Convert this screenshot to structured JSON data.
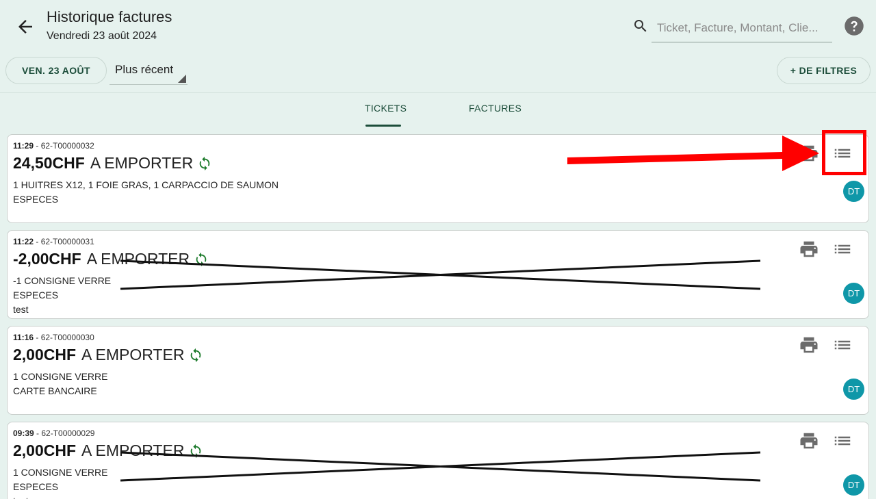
{
  "header": {
    "title": "Historique factures",
    "subtitle": "Vendredi 23 août 2024",
    "search_placeholder": "Ticket, Facture, Montant, Clie..."
  },
  "filters": {
    "date_label": "VEN. 23 AOÛT",
    "sort_value": "Plus récent",
    "more_filters_label": "+ DE FILTRES"
  },
  "tabs": [
    {
      "label": "TICKETS",
      "active": true
    },
    {
      "label": "FACTURES",
      "active": false
    }
  ],
  "tickets": [
    {
      "time": "11:29",
      "sep": " - ",
      "number": "62-T00000032",
      "amount": "24,50CHF",
      "mode": "A EMPORTER",
      "items": "1 HUITRES X12, 1 FOIE GRAS, 1 CARPACCIO DE SAUMON",
      "payment": "ESPECES",
      "note": "",
      "avatar": "DT",
      "crossed": false
    },
    {
      "time": "11:22",
      "sep": " - ",
      "number": "62-T00000031",
      "amount": "-2,00CHF",
      "mode": "A EMPORTER",
      "items": "-1 CONSIGNE VERRE",
      "payment": "ESPECES",
      "note": "test",
      "avatar": "DT",
      "crossed": true
    },
    {
      "time": "11:16",
      "sep": " - ",
      "number": "62-T00000030",
      "amount": "2,00CHF",
      "mode": "A EMPORTER",
      "items": "1 CONSIGNE VERRE",
      "payment": "CARTE BANCAIRE",
      "note": "",
      "avatar": "DT",
      "crossed": false
    },
    {
      "time": "09:39",
      "sep": " - ",
      "number": "62-T00000029",
      "amount": "2,00CHF",
      "mode": "A EMPORTER",
      "items": "1 CONSIGNE VERRE",
      "payment": "ESPECES",
      "note": "test",
      "avatar": "DT",
      "crossed": true
    }
  ],
  "colors": {
    "accent": "#1c4d3a",
    "avatar": "#0f97a8",
    "sync": "#1b7a2a",
    "annotation": "#ff0000"
  },
  "icons": [
    "back-arrow-icon",
    "search-icon",
    "help-icon",
    "print-icon",
    "list-icon",
    "sync-icon"
  ]
}
